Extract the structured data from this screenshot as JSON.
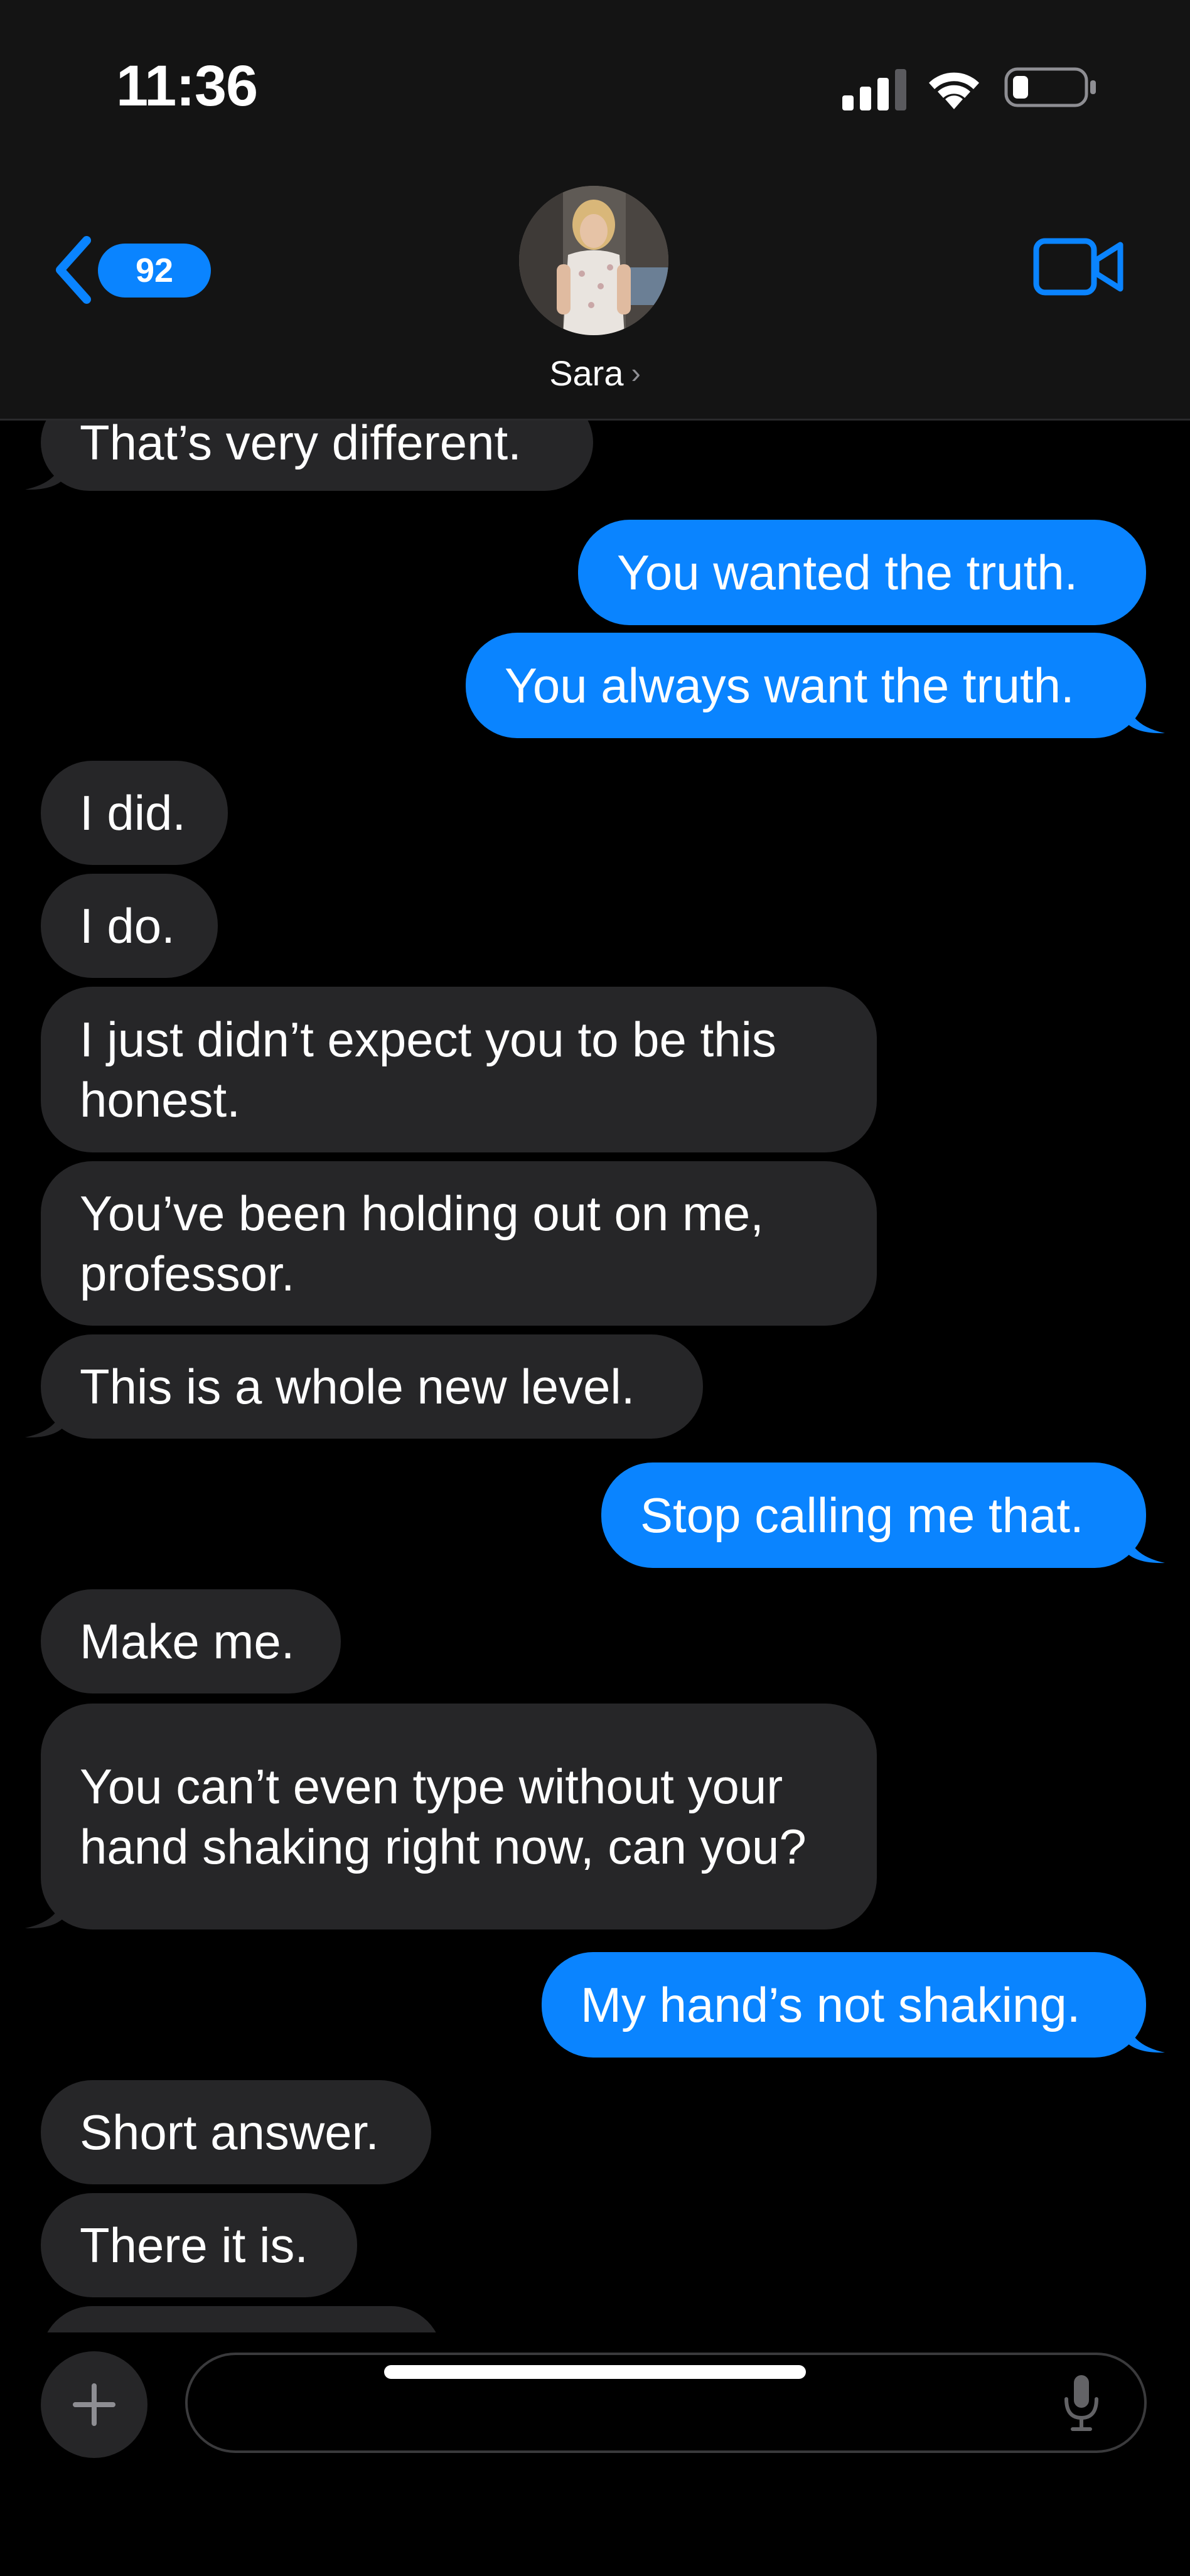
{
  "status_bar": {
    "time": "11:36"
  },
  "header": {
    "back_badge_count": "92",
    "contact_name": "Sara",
    "contact_chevron": "›"
  },
  "messages": [
    {
      "from": "them",
      "text": "That’s very different."
    },
    {
      "from": "me",
      "text": "You wanted the truth."
    },
    {
      "from": "me",
      "text": "You always want the truth."
    },
    {
      "from": "them",
      "text": "I did."
    },
    {
      "from": "them",
      "text": "I do."
    },
    {
      "from": "them",
      "text": "I just didn’t expect you to be this honest."
    },
    {
      "from": "them",
      "text": "You’ve been holding out on me, professor."
    },
    {
      "from": "them",
      "text": "This is a whole new level."
    },
    {
      "from": "me",
      "text": "Stop calling me that."
    },
    {
      "from": "them",
      "text": "Make me."
    },
    {
      "from": "them",
      "text": "You can’t even type without your hand shaking right now, can you?"
    },
    {
      "from": "me",
      "text": "My hand’s not shaking."
    },
    {
      "from": "them",
      "text": "Short answer."
    },
    {
      "from": "them",
      "text": "There it is."
    }
  ],
  "composer": {
    "placeholder": ""
  },
  "icons": {
    "signal": "signal-icon",
    "wifi": "wifi-icon",
    "battery": "battery-icon",
    "back": "chevron-left-icon",
    "video": "video-camera-icon",
    "plus": "plus-icon",
    "mic": "microphone-icon"
  },
  "colors": {
    "sent_bubble": "#0a84ff",
    "received_bubble": "#262628",
    "accent": "#0a84ff",
    "background": "#000000",
    "header_background": "#141414"
  }
}
